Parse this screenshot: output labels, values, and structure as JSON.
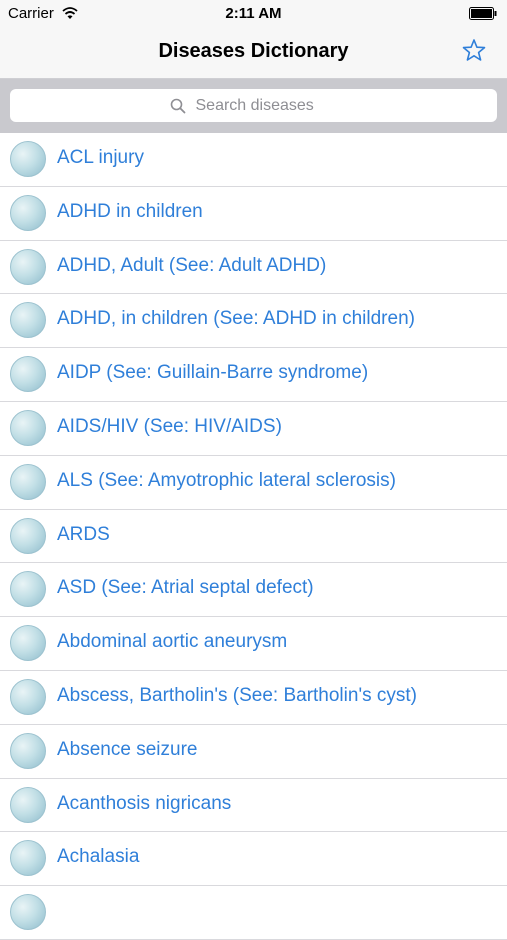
{
  "status_bar": {
    "carrier": "Carrier",
    "time": "2:11 AM"
  },
  "nav": {
    "title": "Diseases Dictionary",
    "favorites_icon": "star-icon"
  },
  "search": {
    "placeholder": "Search diseases",
    "value": ""
  },
  "colors": {
    "link": "#2f7fd9",
    "bar_bg": "#f7f7f7",
    "search_area_bg": "#c9c9ce"
  },
  "diseases": [
    "ACL injury",
    "ADHD in children",
    "ADHD, Adult (See: Adult ADHD)",
    "ADHD, in children (See: ADHD in children)",
    "AIDP (See: Guillain-Barre syndrome)",
    "AIDS/HIV (See: HIV/AIDS)",
    "ALS (See: Amyotrophic lateral sclerosis)",
    "ARDS",
    "ASD (See: Atrial septal defect)",
    "Abdominal aortic aneurysm",
    "Abscess, Bartholin's (See: Bartholin's cyst)",
    "Absence seizure",
    "Acanthosis nigricans",
    "Achalasia",
    ""
  ]
}
